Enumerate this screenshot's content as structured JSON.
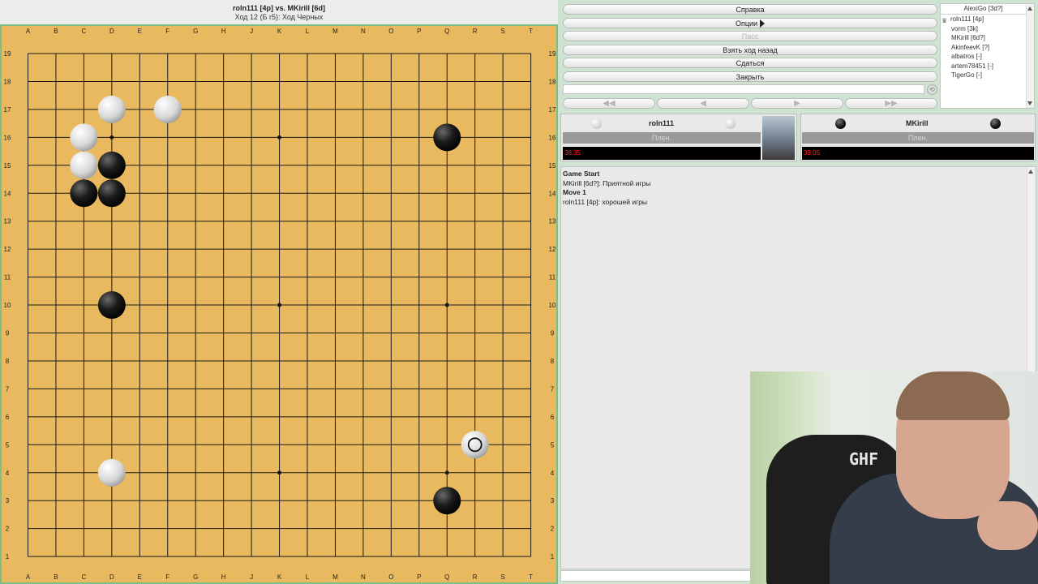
{
  "title": {
    "line1": "roln111 [4p] vs. MKirill [6d]",
    "line2": "Ход 12 (Б r5): Ход Черных"
  },
  "board": {
    "size": 19,
    "columns": [
      "A",
      "B",
      "C",
      "D",
      "E",
      "F",
      "G",
      "H",
      "J",
      "K",
      "L",
      "M",
      "N",
      "O",
      "P",
      "Q",
      "R",
      "S",
      "T"
    ],
    "rows": [
      "19",
      "18",
      "17",
      "16",
      "15",
      "14",
      "13",
      "12",
      "11",
      "10",
      "9",
      "8",
      "7",
      "6",
      "5",
      "4",
      "3",
      "2",
      "1"
    ],
    "hoshi": [
      "D16",
      "K16",
      "Q16",
      "D10",
      "K10",
      "Q10",
      "D4",
      "K4",
      "Q4"
    ],
    "stones": [
      {
        "color": "white",
        "point": "D17"
      },
      {
        "color": "white",
        "point": "F17"
      },
      {
        "color": "white",
        "point": "C16"
      },
      {
        "color": "black",
        "point": "Q16"
      },
      {
        "color": "white",
        "point": "C15"
      },
      {
        "color": "black",
        "point": "D15"
      },
      {
        "color": "black",
        "point": "C14"
      },
      {
        "color": "black",
        "point": "D14"
      },
      {
        "color": "black",
        "point": "D10"
      },
      {
        "color": "white",
        "point": "R5",
        "last_move": true
      },
      {
        "color": "white",
        "point": "D4"
      },
      {
        "color": "black",
        "point": "Q3"
      }
    ],
    "colors": {
      "wood": "#e8b95e",
      "line": "#1a1a1a",
      "border": "#7fbf86"
    }
  },
  "buttons": {
    "help": "Справка",
    "options": "Опции",
    "pass": "Пасс",
    "undo": "Взять ход назад",
    "resign": "Сдаться",
    "close": "Закрыть"
  },
  "nav": {
    "first": "◀◀",
    "prev": "◀",
    "next": "▶",
    "last": "▶▶"
  },
  "userlist": {
    "header": "AlexiGo [3d?]",
    "users": [
      "roln111 [4p]",
      "vorm [3k]",
      "MKirill [6d?]",
      "AkinfeevK [?]",
      "albatros [-]",
      "artem78451 [-]",
      "TigerGo [-]"
    ]
  },
  "players": {
    "white": {
      "name": "roln111",
      "captures_label": "Плен.",
      "time": "38:35"
    },
    "black": {
      "name": "MKirill",
      "captures_label": "Плен.",
      "time": "39:05"
    }
  },
  "chat": {
    "lines": [
      {
        "text": "Game Start",
        "bold": true
      },
      {
        "text": "MKirill [6d?]: Приятной игры",
        "bold": false
      },
      {
        "text": "Move 1",
        "bold": true
      },
      {
        "text": "roln111 [4p]: хорошей игры",
        "bold": false
      }
    ]
  },
  "webcam": {
    "chair_logo": "GHF"
  }
}
